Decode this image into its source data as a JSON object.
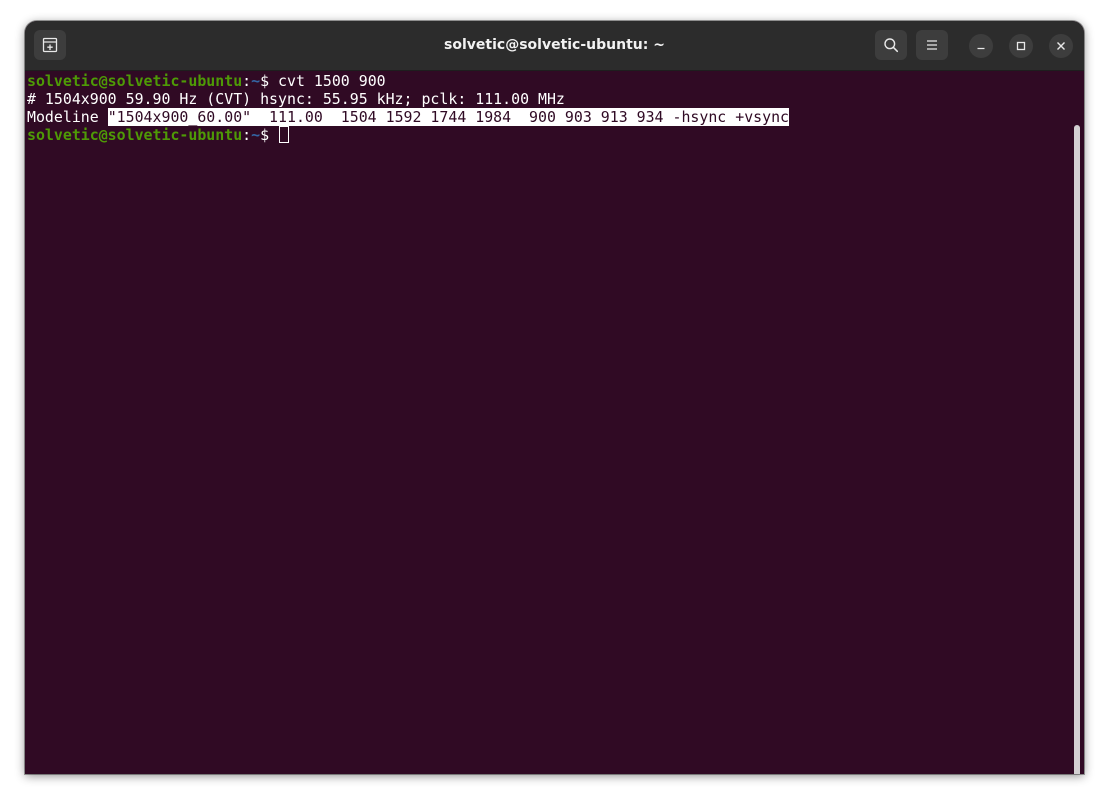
{
  "window": {
    "title": "solvetic@solvetic-ubuntu: ~"
  },
  "terminal": {
    "prompt_user": "solvetic@solvetic-ubuntu",
    "prompt_sep": ":",
    "prompt_path": "~",
    "prompt_symbol": "$",
    "command": " cvt 1500 900",
    "output_line1": "# 1504x900 59.90 Hz (CVT) hsync: 55.95 kHz; pclk: 111.00 MHz",
    "modeline_label": "Modeline ",
    "modeline_value": "\"1504x900_60.00\"  111.00  1504 1592 1744 1984  900 903 913 934 -hsync +vsync"
  },
  "icons": {
    "new_tab": "new-tab-icon",
    "search": "search-icon",
    "menu": "hamburger-menu-icon",
    "minimize": "minimize-icon",
    "maximize": "maximize-icon",
    "close": "close-icon",
    "watermark": "person-logo-icon"
  },
  "colors": {
    "terminal_bg": "#300a24",
    "titlebar_bg": "#2c2c2c",
    "prompt_user": "#4e9a06",
    "prompt_path": "#3465a4",
    "text": "#ffffff"
  }
}
